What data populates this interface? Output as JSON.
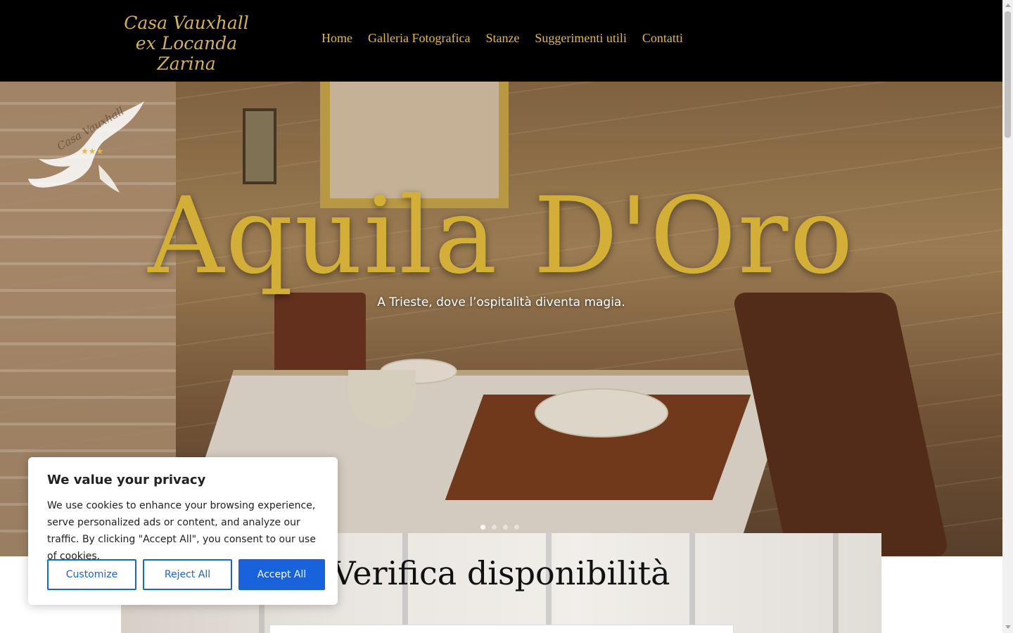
{
  "header": {
    "logo_line1": "Casa Vauxhall",
    "logo_line2": "ex Locanda Zarina",
    "nav": [
      {
        "label": "Home"
      },
      {
        "label": "Galleria Fotografica"
      },
      {
        "label": "Stanze"
      },
      {
        "label": "Suggerimenti utili"
      },
      {
        "label": "Contatti"
      }
    ]
  },
  "hero": {
    "title": "Aquila D'Oro",
    "subtitle": "A Trieste, dove l’ospitalità diventa magia.",
    "watermark_icon": "eagle-logo-icon",
    "slides_total": 4,
    "active_slide": 1
  },
  "availability": {
    "title": "Verifica disponibilità"
  },
  "cookie_banner": {
    "title": "We value your privacy",
    "text": "We use cookies to enhance your browsing experience, serve personalized ads or content, and analyze our traffic. By clicking \"Accept All\", you consent to our use of cookies.",
    "customize_label": "Customize",
    "reject_label": "Reject All",
    "accept_label": "Accept All"
  },
  "colors": {
    "header_bg": "#000000",
    "gold": "#d4af37",
    "nav_gold": "#e0b94a",
    "cookie_blue": "#1863dc"
  }
}
